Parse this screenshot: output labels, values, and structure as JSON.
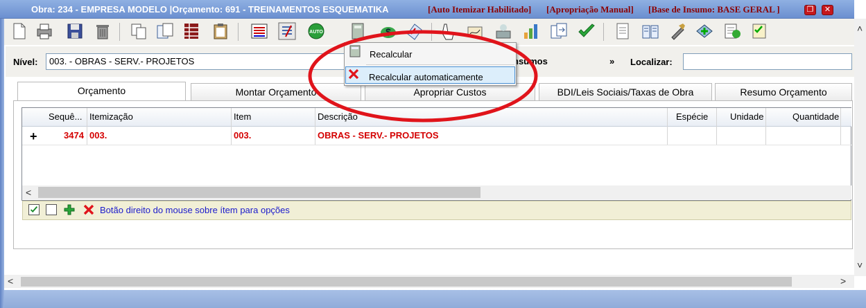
{
  "window": {
    "title": "Obra: 234 - EMPRESA MODELO |Orçamento: 691 - TREINAMENTOS ESQUEMATIKA",
    "flags": [
      "[Auto Itemizar Habilitado]",
      "[Apropriação Manual]",
      "[Base de Insumo: BASE GERAL ]"
    ],
    "restore_glyph": "❐",
    "close_glyph": "✕"
  },
  "toolbar": {
    "auto_badge": "AUTO"
  },
  "level": {
    "label": "Nível:",
    "value": "003. - OBRAS - SERV.- PROJETOS",
    "insumos_label": "nsumos",
    "insumos_arrow": "»",
    "search_label": "Localizar:",
    "search_value": ""
  },
  "tabs": [
    {
      "label": "Orçamento",
      "active": true
    },
    {
      "label": "Montar Orçamento"
    },
    {
      "label": "Apropriar Custos"
    },
    {
      "label": "BDI/Leis Sociais/Taxas de Obra"
    },
    {
      "label": "Resumo Orçamento"
    }
  ],
  "grid": {
    "columns": [
      "Sequê...",
      "Itemização",
      "Item",
      "Descrição",
      "Espécie",
      "Unidade",
      "Quantidade"
    ],
    "rows": [
      {
        "expander": "+",
        "seq": "3474",
        "itemizacao": "003.",
        "item": "003.",
        "descricao": "OBRAS - SERV.- PROJETOS",
        "especie": "",
        "unidade": "",
        "quantidade": ""
      }
    ]
  },
  "footer": {
    "hint": "Botão direito do mouse sobre ítem para opções"
  },
  "context_menu": {
    "items": [
      "Recalcular",
      "Recalcular automaticamente"
    ]
  },
  "scroll": {
    "left": "<",
    "right": ">",
    "up": "^",
    "down": "v"
  },
  "colors": {
    "title_flag": "#8b0000",
    "row_text": "#d40000",
    "hint_text": "#1a1acc",
    "annotation": "#e0141b"
  }
}
